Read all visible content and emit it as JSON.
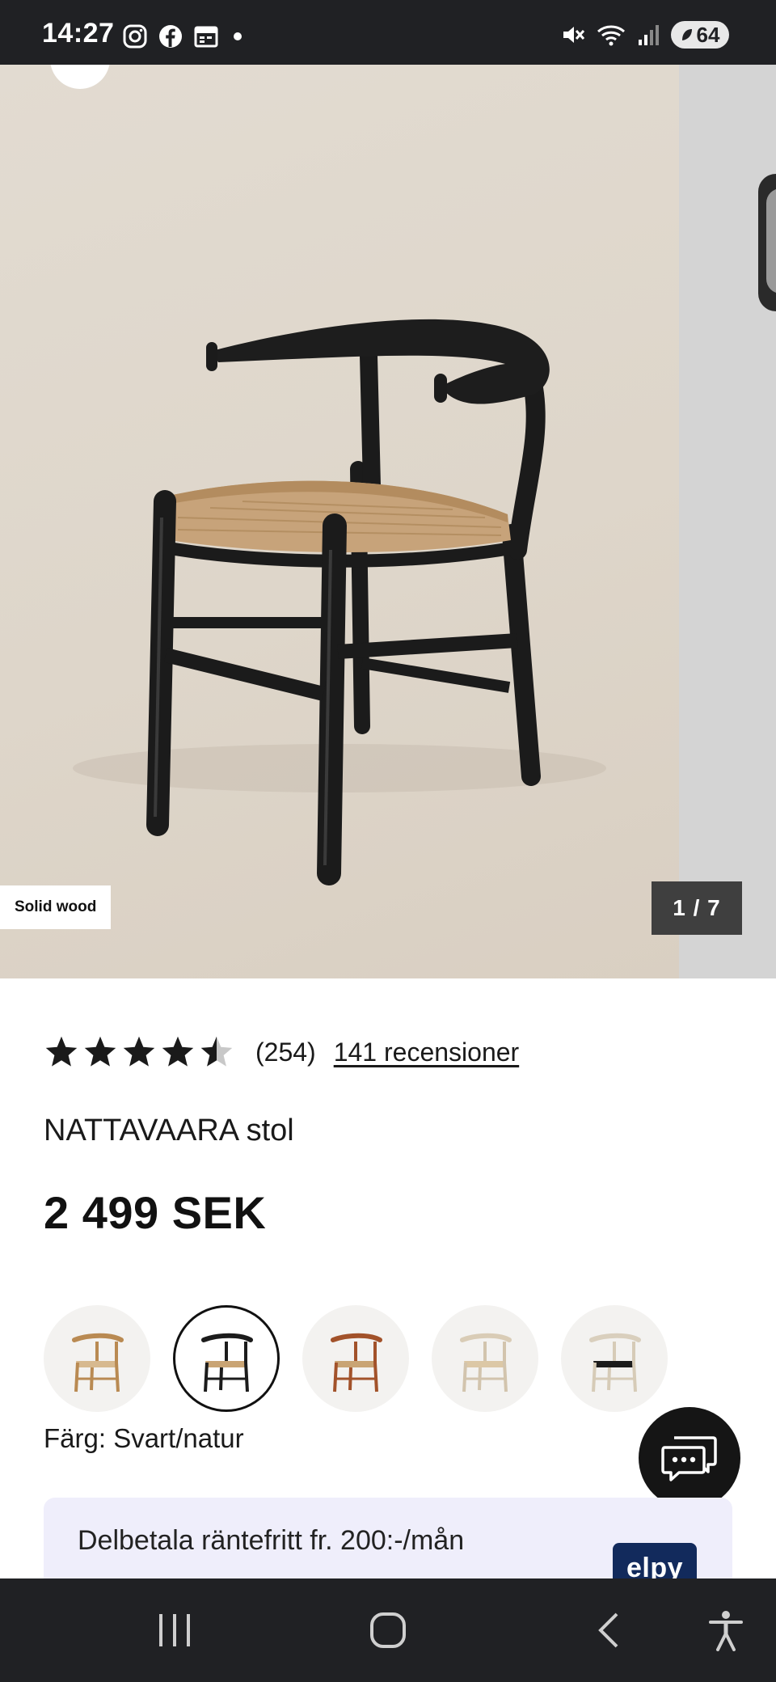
{
  "status_bar": {
    "time": "14:27",
    "left_icons": [
      "instagram-icon",
      "facebook-icon",
      "calendar-icon",
      "dot-icon"
    ],
    "right_icons": [
      "mute-icon",
      "wifi-icon",
      "signal-icon"
    ],
    "battery": "64"
  },
  "gallery": {
    "material_badge": "Solid wood",
    "counter": "1 / 7",
    "image_subject": "chair-photo"
  },
  "product": {
    "rating": 4.5,
    "rating_count": "(254)",
    "reviews_link": "141 recensioner",
    "title": "NATTAVAARA stol",
    "price": "2 499 SEK"
  },
  "colors": {
    "options": [
      {
        "wood": "#b98a52",
        "seat": "#d7b98f"
      },
      {
        "wood": "#1c1c1c",
        "seat": "#c9a474"
      },
      {
        "wood": "#a2522a",
        "seat": "#c9a474"
      },
      {
        "wood": "#e2d7c5",
        "seat": "#d8c4a2"
      },
      {
        "wood": "#e4dccd",
        "seat": "#1c1c1c"
      }
    ],
    "selected_index": 1,
    "label": "Färg: Svart/natur"
  },
  "installment": {
    "text": "Delbetala räntefritt fr. 200:-/mån",
    "logo": "elpy"
  },
  "accent_colors": {
    "status_bar": "#202124",
    "badge_dark": "#3f3f3f",
    "banner_bg": "#efeefb",
    "logo_bg": "#122a5c"
  },
  "nav_bar": {
    "buttons": [
      "recent-apps-icon",
      "home-icon",
      "back-icon",
      "accessibility-icon"
    ]
  }
}
